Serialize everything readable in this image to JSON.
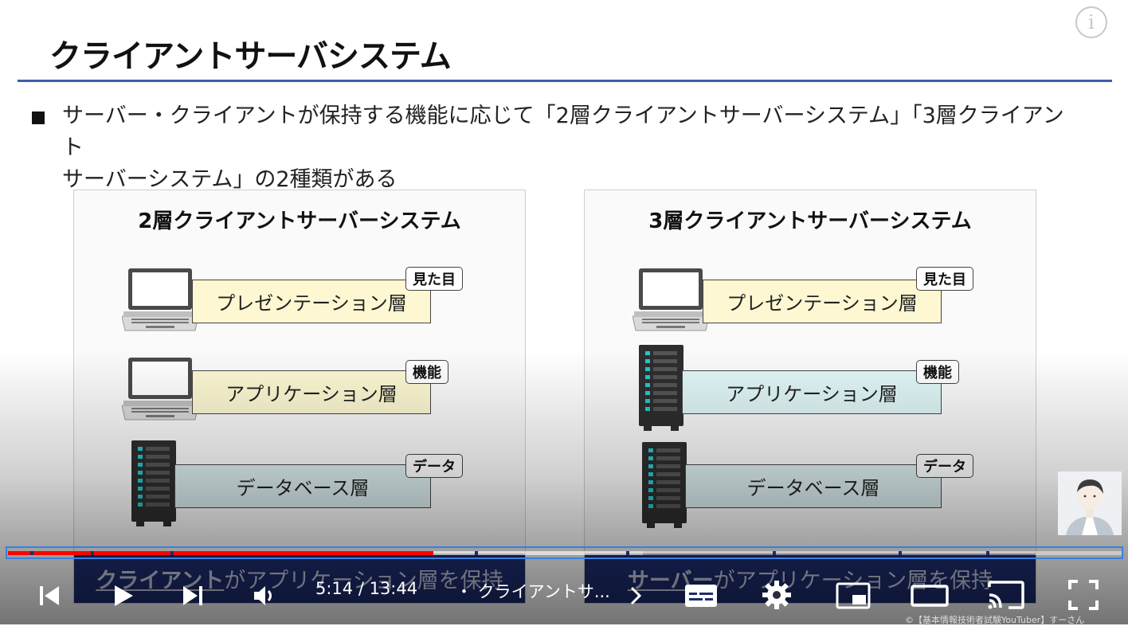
{
  "slide": {
    "title": "クライアントサーバシステム",
    "bullet_line1": "サーバー・クライアントが保持する機能に応じて「2層クライアントサーバーシステム」「3層クライアント",
    "bullet_line2": "サーバーシステム」の2種類がある"
  },
  "panels": {
    "left": {
      "title": "2層クライアントサーバーシステム",
      "layers": [
        {
          "label": "プレゼンテーション層",
          "tag": "見た目"
        },
        {
          "label": "アプリケーション層",
          "tag": "機能"
        },
        {
          "label": "データベース層",
          "tag": "データ"
        }
      ],
      "caption_em": "クライアント",
      "caption_rest": "がアプリケーション層を保持"
    },
    "right": {
      "title": "3層クライアントサーバーシステム",
      "layers": [
        {
          "label": "プレゼンテーション層",
          "tag": "見た目"
        },
        {
          "label": "アプリケーション層",
          "tag": "機能"
        },
        {
          "label": "データベース層",
          "tag": "データ"
        }
      ],
      "caption_em": "サーバー",
      "caption_rest": "がアプリケーション層を保持"
    }
  },
  "player": {
    "time": "5:14 / 13:44",
    "chapter": "・ クライアントサ...",
    "played_fraction": 0.382,
    "buffered_fraction": 0.57,
    "copyright": "©【基本情報技術者試験YouTuber】すーさん"
  },
  "icons": [
    "info-icon",
    "laptop-icon",
    "server-icon",
    "previous-icon",
    "play-icon",
    "next-icon",
    "volume-icon",
    "chevron-right-icon",
    "subtitles-icon",
    "settings-icon",
    "miniplayer-icon",
    "theater-icon",
    "cast-icon",
    "fullscreen-icon"
  ],
  "colors": {
    "accent": "#3f5ea8",
    "caption_bg": "#1d2c6e",
    "progress": "#ff0000"
  }
}
